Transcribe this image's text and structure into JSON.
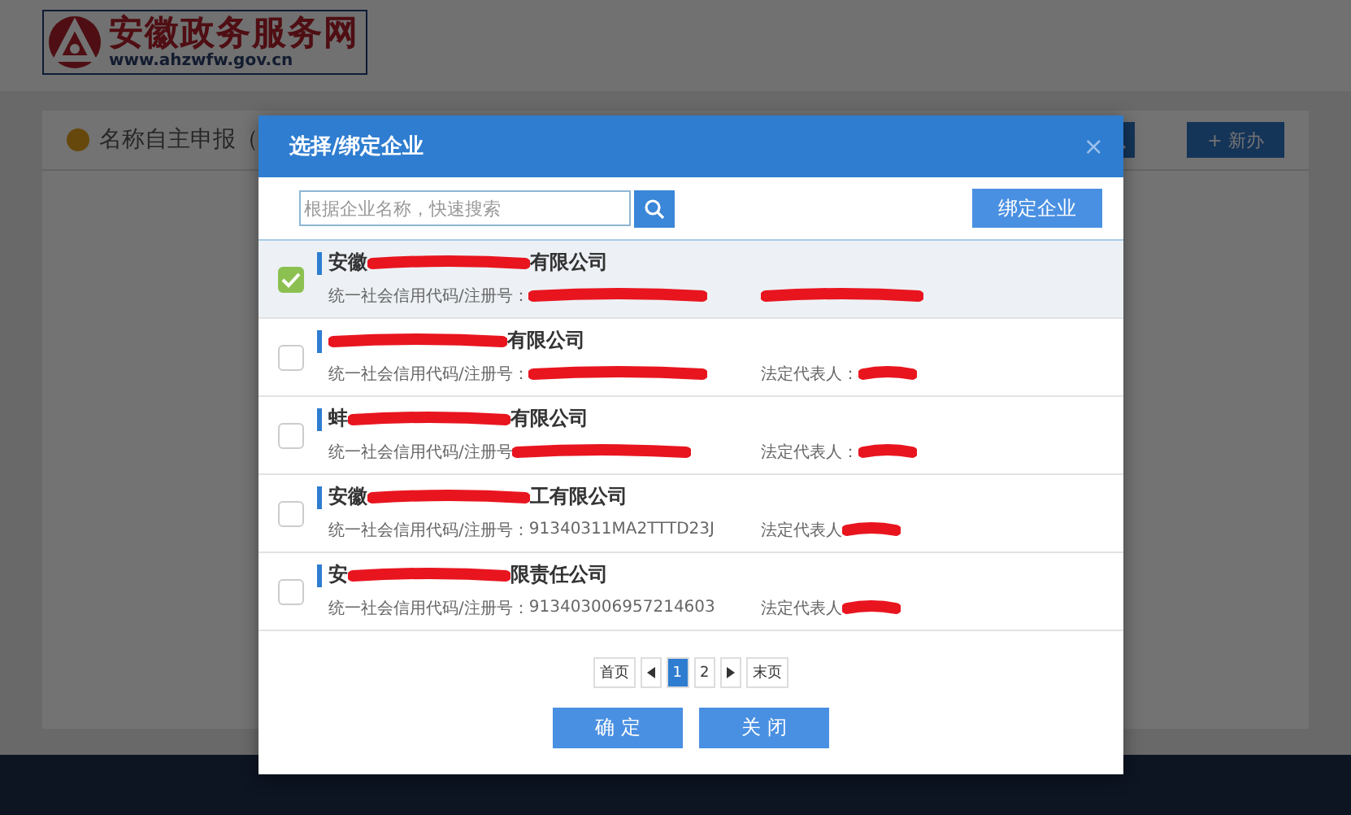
{
  "site": {
    "logo_title": "安徽政务服务网",
    "logo_url": "www.ahzwfw.gov.cn"
  },
  "page": {
    "tab_label": "名称自主申报（",
    "new_button": "+ 新办"
  },
  "dialog": {
    "title": "选择/绑定企业",
    "close": "×",
    "search": {
      "placeholder": "根据企业名称，快速搜索"
    },
    "bind_button": "绑定企业",
    "companies": [
      {
        "selected": true,
        "name_start": "安徽",
        "name_end": "有限公司",
        "code_label": "统一社会信用代码/注册号："
      },
      {
        "selected": false,
        "name_end": "有限公司",
        "code_label": "统一社会信用代码/注册号：",
        "rep_label": "法定代表人："
      },
      {
        "selected": false,
        "name_start": "蚌",
        "name_end": "有限公司",
        "code_label": "统一社会信用代码/注册号",
        "rep_label": "法定代表人："
      },
      {
        "selected": false,
        "name_start": "安徽",
        "name_end": "工有限公司",
        "code_label": "统一社会信用代码/注册号：",
        "code": "91340311MA2TTTD23J",
        "rep_label": "法定代表人"
      },
      {
        "selected": false,
        "name_start": "安",
        "name_end": "限责任公司",
        "code_label": "统一社会信用代码/注册号：",
        "code": "913403006957214603",
        "rep_label": "法定代表人"
      }
    ],
    "pagination": {
      "first": "首页",
      "pages": [
        {
          "label": "1",
          "selected": true
        },
        {
          "label": "2",
          "selected": false
        }
      ],
      "last": "末页"
    },
    "buttons": [
      "确 定",
      "关 闭"
    ]
  }
}
